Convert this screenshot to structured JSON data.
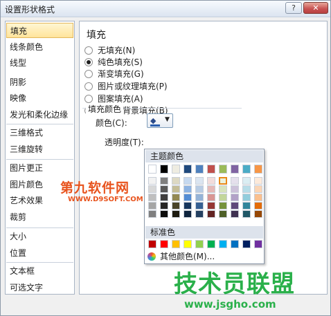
{
  "window": {
    "title": "设置形状格式",
    "help_glyph": "?",
    "close_glyph": "✕"
  },
  "sidebar": {
    "items": [
      {
        "label": "填充",
        "selected": true
      },
      {
        "label": "线条颜色"
      },
      {
        "label": "线型"
      },
      {
        "label": "阴影"
      },
      {
        "label": "映像"
      },
      {
        "label": "发光和柔化边缘"
      },
      {
        "label": "三维格式"
      },
      {
        "label": "三维旋转"
      },
      {
        "label": "图片更正"
      },
      {
        "label": "图片颜色"
      },
      {
        "label": "艺术效果"
      },
      {
        "label": "裁剪"
      },
      {
        "label": "大小"
      },
      {
        "label": "位置"
      },
      {
        "label": "文本框"
      },
      {
        "label": "可选文字"
      }
    ]
  },
  "panel": {
    "title": "填充",
    "options": [
      {
        "label": "无填充(N)",
        "checked": false
      },
      {
        "label": "纯色填充(S)",
        "checked": true
      },
      {
        "label": "渐变填充(G)",
        "checked": false
      },
      {
        "label": "图片或纹理填充(P)",
        "checked": false
      },
      {
        "label": "图案填充(A)",
        "checked": false
      },
      {
        "label": "幻灯片背景填充(B)",
        "checked": false
      }
    ],
    "fill_color_group": "填充颜色",
    "color_label": "颜色(C):",
    "transparency_label": "透明度(T):",
    "color_button_icon": "paint-bucket-icon",
    "color_button_accent": "#2b5fb0"
  },
  "color_popup": {
    "theme_header": "主题颜色",
    "standard_header": "标准色",
    "more_colors": "其他颜色(M)...",
    "theme_colors": [
      [
        "#ffffff",
        "#f2f2f2",
        "#d8d8d8",
        "#bfbfbf",
        "#a5a5a5",
        "#7f7f7f"
      ],
      [
        "#000000",
        "#7f7f7f",
        "#595959",
        "#3f3f3f",
        "#262626",
        "#0c0c0c"
      ],
      [
        "#eeece1",
        "#ddd9c3",
        "#c4bd97",
        "#938953",
        "#494429",
        "#1d1b10"
      ],
      [
        "#1f497d",
        "#c6d9f0",
        "#8db3e2",
        "#548dd4",
        "#17365d",
        "#0f243e"
      ],
      [
        "#4f81bd",
        "#dbe5f1",
        "#b8cce4",
        "#95b3d7",
        "#366092",
        "#244061"
      ],
      [
        "#c0504d",
        "#f2dcdb",
        "#e5b9b7",
        "#d99694",
        "#953734",
        "#632423"
      ],
      [
        "#9bbb59",
        "#ebf1dd",
        "#d7e3bc",
        "#c3d69b",
        "#76923c",
        "#4f6128"
      ],
      [
        "#8064a2",
        "#e5e0ec",
        "#ccc1d9",
        "#b2a2c7",
        "#5f497a",
        "#3f3151"
      ],
      [
        "#4bacc6",
        "#dbeef3",
        "#b7dde8",
        "#92cddc",
        "#31859b",
        "#205867"
      ],
      [
        "#f79646",
        "#fdeada",
        "#fbd5b5",
        "#fac08f",
        "#e36c09",
        "#974806"
      ]
    ],
    "selected_theme": {
      "column": 6,
      "row": 1
    },
    "standard_colors": [
      "#c00000",
      "#ff0000",
      "#ffc000",
      "#ffff00",
      "#92d050",
      "#00b050",
      "#00b0f0",
      "#0070c0",
      "#002060",
      "#7030a0"
    ]
  },
  "watermarks": {
    "site1_text": "第九软件网",
    "site1_url": "WWW.D9SOFT.COM",
    "site2_text": "技术员联盟",
    "site2_url": "www.jsgho.com"
  }
}
